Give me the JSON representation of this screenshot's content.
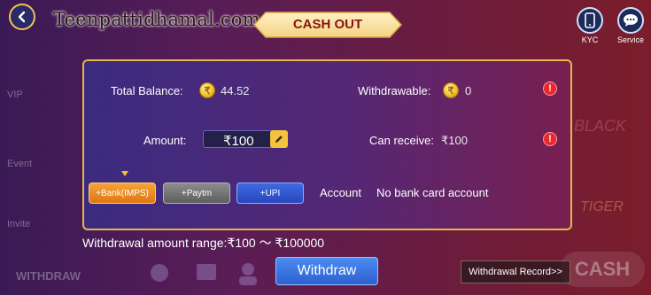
{
  "header": {
    "brand": "Teenpattidhamal.com",
    "title": "CASH OUT",
    "kyc_label": "KYC",
    "service_label": "Service"
  },
  "background": {
    "side_labels": [
      "VIP",
      "Event",
      "Invite"
    ],
    "black_text": "BLACK",
    "tiger_text": "TIGER",
    "cash_text": "CASH",
    "withdraw_text": "WITHDRAW"
  },
  "panel": {
    "total_balance_label": "Total Balance:",
    "total_balance_value": "44.52",
    "withdrawable_label": "Withdrawable:",
    "withdrawable_value": "0",
    "amount_label": "Amount:",
    "amount_value": "₹100",
    "can_receive_label": "Can receive:",
    "can_receive_value": "₹100",
    "methods": [
      "+Bank(IMPS)",
      "+Paytm",
      "+UPI"
    ],
    "account_label": "Account",
    "account_value": "No bank card account"
  },
  "footer": {
    "range_text": "Withdrawal amount range:₹100 ～ ₹100000",
    "withdraw_button": "Withdraw",
    "record_button": "Withdrawal Record>>"
  },
  "colors": {
    "accent_gold": "#e6b64c",
    "primary_blue": "#2e60cf",
    "alert_red": "#e8282e",
    "bank_orange": "#e07612"
  },
  "icons": {
    "back": "back-arrow-icon",
    "kyc": "phone-icon",
    "service": "chat-icon",
    "coin": "coin-icon",
    "alert": "alert-icon",
    "edit": "pencil-icon"
  }
}
